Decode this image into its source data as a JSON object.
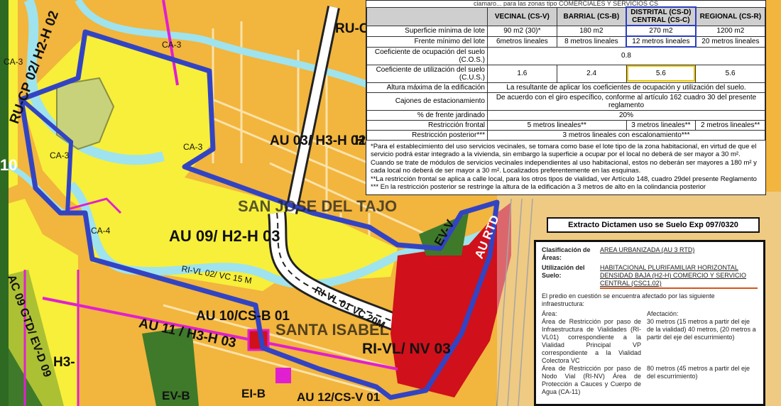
{
  "table": {
    "top_cut": "ciamaro... para las zonas tipo COMERCIALES Y SERVICIOS CS",
    "headers": [
      "VECINAL (CS-V)",
      "BARRIAL (CS-B)",
      "DISTRITAL (CS-D) CENTRAL (CS-C)",
      "REGIONAL (CS-R)"
    ],
    "rows": [
      {
        "label": "Superficie mínima de lote",
        "cells": [
          "90 m2 (30)*",
          "180 m2",
          "270 m2",
          "1200 m2"
        ]
      },
      {
        "label": "Frente mínimo del lote",
        "cells": [
          "6metros lineales",
          "8 metros lineales",
          "12 metros lineales",
          "20 metros lineales"
        ]
      },
      {
        "label": "Coeficiente de ocupación del suelo (C.O.S.)",
        "span": "0.8"
      },
      {
        "label": "Coeficiente de utilización del suelo (C.U.S.)",
        "cells": [
          "1.6",
          "2.4",
          "5.6",
          "5.6"
        ]
      },
      {
        "label": "Altura máxima de la edificación",
        "span": "La resultante de aplicar los coeficientes de ocupación y utilización del suelo."
      },
      {
        "label": "Cajones de estacionamiento",
        "span": "De acuerdo con el giro específico, conforme al artículo 162 cuadro 30 del presente reglamento"
      },
      {
        "label": "% de frente jardinado",
        "span": "20%"
      },
      {
        "label": "Restricción frontal",
        "cells3": [
          "5 metros lineales**",
          "3 metros lineales**",
          "2 metros lineales**"
        ]
      },
      {
        "label": "Restricción posterior***",
        "span": "3 metros lineales con escalonamiento***"
      }
    ],
    "notes": [
      "*Para el establecimiento del uso servicios vecinales, se tomara como base el lote tipo de la zona habitacional, en virtud de que el servicio podrá estar integrado a la vivienda, sin embargo la superficie a ocupar por el local no deberá de ser mayor a 30 m².",
      "Cuando se trate de módulos de servicios vecinales independientes al uso habitacional, estos no deberán ser mayores a 180 m² y cada local no deberá de ser mayor a 30 m². Localizados preferentemente en las esquinas.",
      "**La restricción frontal se aplica a calle local, para los otros tipos de vialidad, ver Artículo 148, cuadro 29del presente Reglamento",
      "*** En la restricción posterior se restringe la altura de la edificación a 3 metros de alto en la colindancia posterior"
    ]
  },
  "caption": "Extracto Dictamen uso se Suelo  Exp 097/0320",
  "dictamen": {
    "clasificacion_label": "Clasificación de Áreas:",
    "clasificacion_value": "AREA URBANIZADA (AU 3 RTD)",
    "utilizacion_label": "Utilización del Suelo:",
    "utilizacion_value": "HABITACIONAL PLURIFAMILIAR HORIZONTAL DENSIDAD BAJA (H2-H) COMERCIO Y SERVICIO CENTRAL (CSC1.02)",
    "intro": "El predio en cuestión se encuentra afectado por las siguiente infraestructura:",
    "col_area": "Área:",
    "col_afectacion": "Afectación:",
    "items": [
      {
        "area": "Área de Restricción por paso de Infraestructura de Vialidades (RI-VL01) correspondiente a la Vialidad Principal VP correspondiente a la Vialidad Colectora VC",
        "afectacion": "30 metros (15 metros a partir del eje de la vialidad) 40 metros, (20 metros a partir del eje del escurrimiento)"
      },
      {
        "area": "Área de Restricción por paso de Nodo Vial (RI-NV) Área de Protección a Cauces y Cuerpo de Agua (CA-11)",
        "afectacion": "80 metros (45 metros a partir del eje del escurrimiento)"
      }
    ]
  },
  "map_labels": {
    "ru_cp": "RU-CP 02/ H2-H 02",
    "ca3a": "CA-3",
    "ca3b": "CA-3",
    "ca3c": "CA-3",
    "ca3d": "CA-3",
    "ca4": "CA-4",
    "au03": "AU 03/ H3-H 02",
    "san_jose": "SAN JOSE DEL TAJO",
    "au09": "AU 09/ H2-H 03",
    "ri_vl01": "RI-VL 01 VC 20M",
    "au10": "AU 10/CS-B 01",
    "au11": "AU 11 / H3-H 03",
    "santa_isabel": "SANTA ISABEL",
    "ri_vl_nv": "RI-VL/ NV 03",
    "ev_v": "EV-V",
    "au_rtd": "AU RTD",
    "ri_vl02": "RI-VL 02/ VC 15 M",
    "ru_top": "RU-C",
    "ei_b": "EI-B",
    "au12": "AU 12/CS-V 01",
    "ev_b": "EV-B",
    "ac09": "AC 09 GTD/ EV-D 09",
    "ten": "10",
    "h3": "H3-",
    "h3b": "H3-"
  },
  "colors": {
    "yellow": "#f7ef3a",
    "orange": "#f2b53d",
    "blue_boundary": "#3344c2",
    "magenta": "#e020d0",
    "red": "#d0101a",
    "green": "#3e7a2a",
    "water": "#9fe3ee"
  }
}
